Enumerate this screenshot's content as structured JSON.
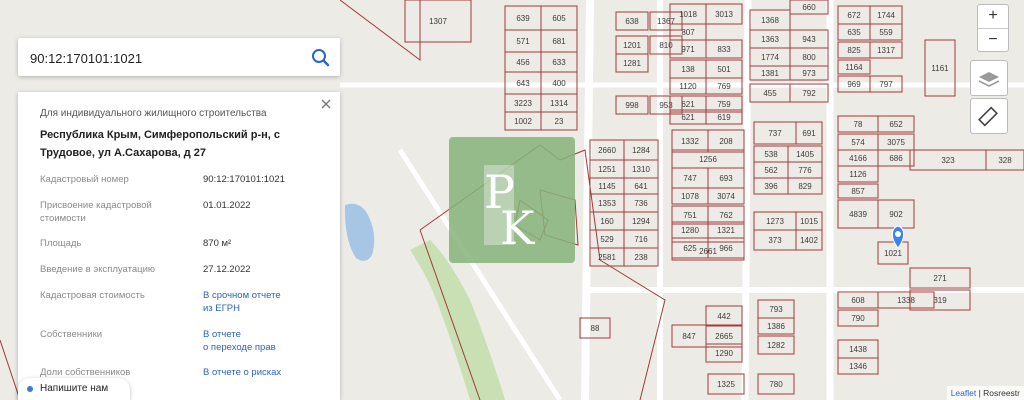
{
  "search": {
    "value": "90:12:170101:1021",
    "button_icon": "search-icon"
  },
  "info": {
    "type": "Для индивидуального жилищного строительства",
    "address": "Республика Крым, Симферопольский р-н, с Трудовое, ул А.Сахарова, д 27",
    "rows": [
      {
        "key": "Кадастровый номер",
        "value": "90:12:170101:1021"
      },
      {
        "key": "Присвоение кадастровой стоимости",
        "value": "01.01.2022"
      },
      {
        "key": "Площадь",
        "value": "870 м²"
      },
      {
        "key": "Введение в эксплуатацию",
        "value": "27.12.2022"
      },
      {
        "key": "Кадастровая стоимость",
        "link1": "В срочном отчете",
        "link2": "из ЕГРН"
      },
      {
        "key": "Собственники",
        "link1": "В отчете",
        "link2": "о переходе прав"
      },
      {
        "key": "Доли собственников",
        "link1": "В отчете о рисках"
      }
    ]
  },
  "chat": {
    "label": "Напишите нам"
  },
  "controls": {
    "zoom_in": "+",
    "zoom_out": "−"
  },
  "attribution": {
    "leaflet": "Leaflet",
    "sep": " | ",
    "source": "Rosreestr"
  },
  "parcels": [
    {
      "l": "1307"
    },
    {
      "l": "639"
    },
    {
      "l": "605"
    },
    {
      "l": "571"
    },
    {
      "l": "681"
    },
    {
      "l": "456"
    },
    {
      "l": "633"
    },
    {
      "l": "643"
    },
    {
      "l": "400"
    },
    {
      "l": "3223"
    },
    {
      "l": "1314"
    },
    {
      "l": "1002"
    },
    {
      "l": "23"
    },
    {
      "l": "638"
    },
    {
      "l": "1367"
    },
    {
      "l": "1201"
    },
    {
      "l": "810"
    },
    {
      "l": "1281"
    },
    {
      "l": "998"
    },
    {
      "l": "953"
    },
    {
      "l": "1018"
    },
    {
      "l": "3013"
    },
    {
      "l": "807"
    },
    {
      "l": "971"
    },
    {
      "l": "833"
    },
    {
      "l": "138"
    },
    {
      "l": "501"
    },
    {
      "l": "1120"
    },
    {
      "l": "769"
    },
    {
      "l": "621"
    },
    {
      "l": "759"
    },
    {
      "l": "621"
    },
    {
      "l": "619"
    },
    {
      "l": "1368"
    },
    {
      "l": "660"
    },
    {
      "l": "1363"
    },
    {
      "l": "943"
    },
    {
      "l": "1774"
    },
    {
      "l": "800"
    },
    {
      "l": "1381"
    },
    {
      "l": "973"
    },
    {
      "l": "455"
    },
    {
      "l": "792"
    },
    {
      "l": "672"
    },
    {
      "l": "1744"
    },
    {
      "l": "635"
    },
    {
      "l": "559"
    },
    {
      "l": "825"
    },
    {
      "l": "1317"
    },
    {
      "l": "1164"
    },
    {
      "l": "969"
    },
    {
      "l": "797"
    },
    {
      "l": "1161"
    },
    {
      "l": "2660"
    },
    {
      "l": "1284"
    },
    {
      "l": "1251"
    },
    {
      "l": "1310"
    },
    {
      "l": "1145"
    },
    {
      "l": "641"
    },
    {
      "l": "1353"
    },
    {
      "l": "736"
    },
    {
      "l": "160"
    },
    {
      "l": "1294"
    },
    {
      "l": "529"
    },
    {
      "l": "716"
    },
    {
      "l": "2581"
    },
    {
      "l": "238"
    },
    {
      "l": "1332"
    },
    {
      "l": "208"
    },
    {
      "l": "1256"
    },
    {
      "l": "747"
    },
    {
      "l": "693"
    },
    {
      "l": "1078"
    },
    {
      "l": "3074"
    },
    {
      "l": "751"
    },
    {
      "l": "762"
    },
    {
      "l": "1280"
    },
    {
      "l": "1321"
    },
    {
      "l": "625"
    },
    {
      "l": "2661"
    },
    {
      "l": "966"
    },
    {
      "l": "737"
    },
    {
      "l": "691"
    },
    {
      "l": "538"
    },
    {
      "l": "1405"
    },
    {
      "l": "562"
    },
    {
      "l": "776"
    },
    {
      "l": "396"
    },
    {
      "l": "829"
    },
    {
      "l": "1273"
    },
    {
      "l": "1015"
    },
    {
      "l": "373"
    },
    {
      "l": "1402"
    },
    {
      "l": "78"
    },
    {
      "l": "652"
    },
    {
      "l": "574"
    },
    {
      "l": "3075"
    },
    {
      "l": "4166"
    },
    {
      "l": "686"
    },
    {
      "l": "1126"
    },
    {
      "l": "857"
    },
    {
      "l": "4839"
    },
    {
      "l": "902"
    },
    {
      "l": "1021"
    },
    {
      "l": "323"
    },
    {
      "l": "328"
    },
    {
      "l": "271"
    },
    {
      "l": "319"
    },
    {
      "l": "608"
    },
    {
      "l": "1338"
    },
    {
      "l": "790"
    },
    {
      "l": "1438"
    },
    {
      "l": "1346"
    },
    {
      "l": "442"
    },
    {
      "l": "847"
    },
    {
      "l": "2665"
    },
    {
      "l": "1290"
    },
    {
      "l": "1282"
    },
    {
      "l": "793"
    },
    {
      "l": "1386"
    },
    {
      "l": "780"
    },
    {
      "l": "1325"
    },
    {
      "l": "88"
    }
  ]
}
